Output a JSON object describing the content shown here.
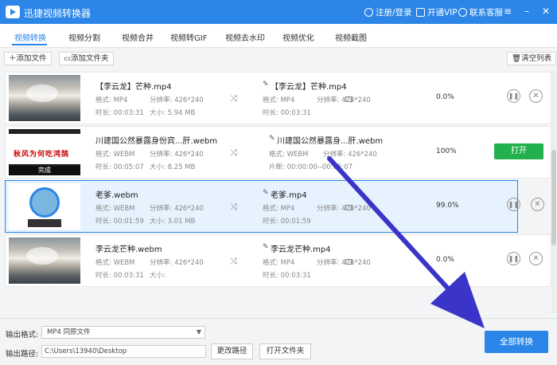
{
  "titlebar": {
    "title": "迅捷视频转换器",
    "login": "注册/登录",
    "vip": "开通VIP",
    "support": "联系客服"
  },
  "tabs": [
    "视频转换",
    "视频分割",
    "视频合并",
    "视频转GIF",
    "视频去水印",
    "视频优化",
    "视频截图"
  ],
  "toolbar": {
    "add_file": "添加文件",
    "add_folder": "添加文件夹",
    "clear_list": "清空列表"
  },
  "labels": {
    "format": "格式:",
    "resolution": "分辨率:",
    "duration": "时长:",
    "size": "大小:",
    "clip": "片断:"
  },
  "rows": [
    {
      "name": "【李云龙】芒种.mp4",
      "format": "MP4",
      "resolution": "426*240",
      "duration": "00:03:31",
      "size": "5.94 MB",
      "out_name": "【李云龙】芒种.mp4",
      "out_format": "MP4",
      "out_resolution": "426*240",
      "out_duration": "00:03:31",
      "progress": "0.0%"
    },
    {
      "name": "川建国公然暴露身份宾...肝.webm",
      "format": "WEBM",
      "resolution": "426*240",
      "duration": "00:05:07",
      "size": "8.25 MB",
      "out_name": "川建国公然暴露身...肝.webm",
      "out_format": "WEBM",
      "out_resolution": "426*240",
      "out_clip": "00:00:00--00:05:07",
      "progress": "100%",
      "open": "打开",
      "thumb_text": "秋风为何吃鸿鹄",
      "thumb_badge": "完成"
    },
    {
      "name": "老爹.webm",
      "format": "WEBM",
      "resolution": "426*240",
      "duration": "00:01:59",
      "size": "3.01 MB",
      "out_name": "老爹.mp4",
      "out_format": "MP4",
      "out_resolution": "426*240",
      "out_duration": "00:01:59",
      "progress": "99.0%"
    },
    {
      "name": "李云龙芒种.webm",
      "format": "WEBM",
      "resolution": "426*240",
      "duration": "00:03:31",
      "size": "",
      "out_name": "李云龙芒种.mp4",
      "out_format": "MP4",
      "out_resolution": "426*240",
      "out_duration": "00:03:31",
      "progress": "0.0%"
    }
  ],
  "bottom": {
    "format_label": "输出格式:",
    "format_value": "MP4  同原文件",
    "path_label": "输出路径:",
    "path_value": "C:\\Users\\13940\\Desktop",
    "change_path": "更改路径",
    "open_folder": "打开文件夹",
    "convert_all": "全部转换"
  },
  "colors": {
    "accent": "#2b86e8",
    "success": "#22b14c",
    "annotation_arrow": "#3a35c8"
  }
}
